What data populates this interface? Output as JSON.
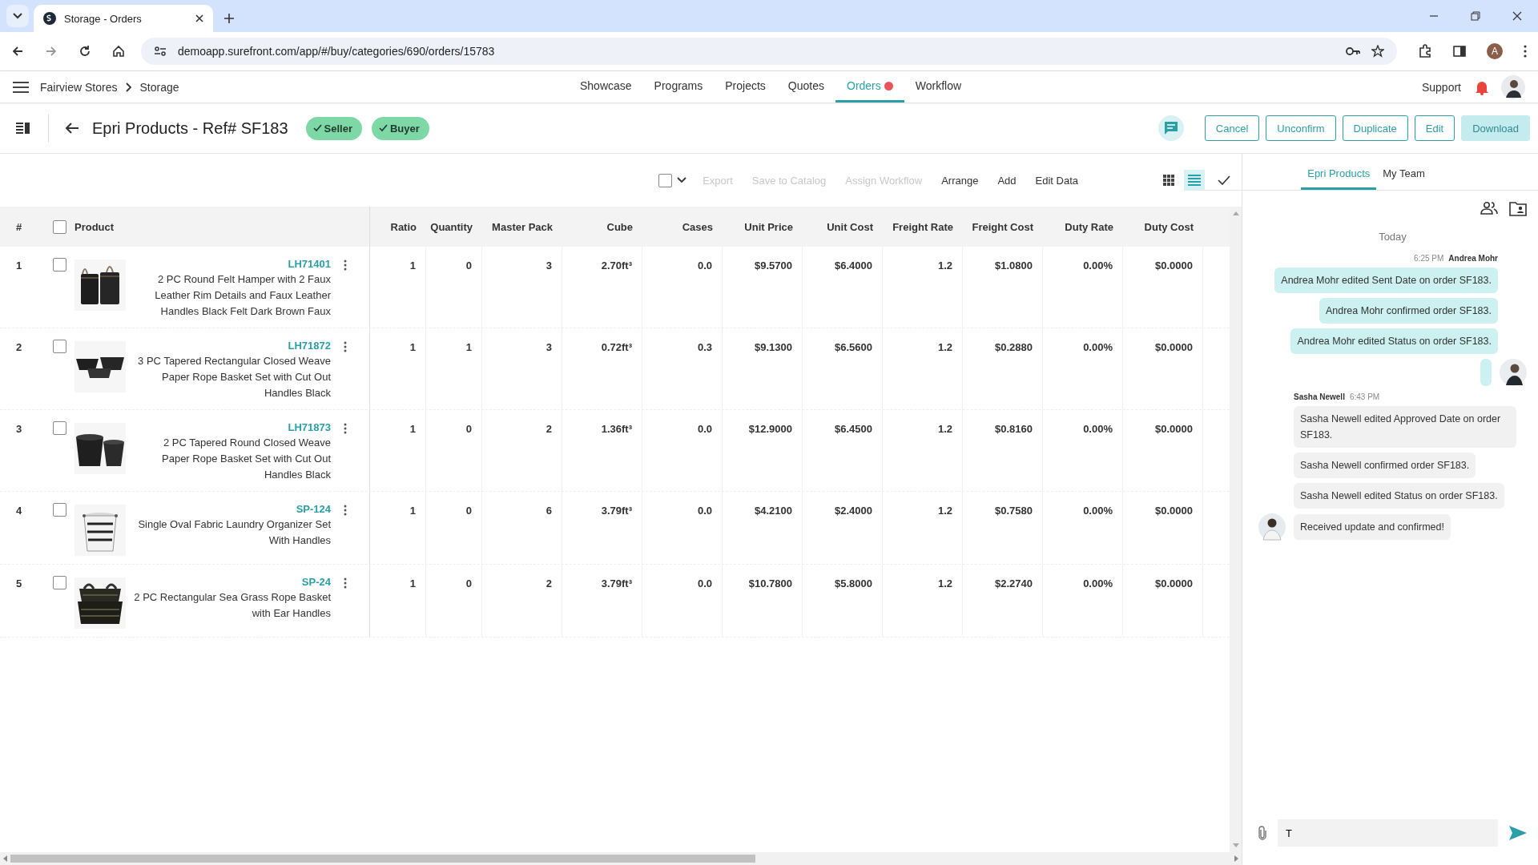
{
  "browser": {
    "tab_title": "Storage - Orders",
    "url": "demoapp.surefront.com/app/#/buy/categories/690/orders/15783",
    "profile_initial": "A"
  },
  "app_nav": {
    "breadcrumb": [
      "Fairview Stores",
      "Storage"
    ],
    "items": [
      {
        "label": "Showcase",
        "selected": false,
        "notification": false
      },
      {
        "label": "Programs",
        "selected": false,
        "notification": false
      },
      {
        "label": "Projects",
        "selected": false,
        "notification": false
      },
      {
        "label": "Quotes",
        "selected": false,
        "notification": false
      },
      {
        "label": "Orders",
        "selected": true,
        "notification": true
      },
      {
        "label": "Workflow",
        "selected": false,
        "notification": false
      }
    ],
    "support": "Support"
  },
  "header": {
    "title": "Epri Products - Ref# SF183",
    "badges": [
      "Seller",
      "Buyer"
    ],
    "buttons": [
      {
        "label": "Cancel",
        "disabled": false
      },
      {
        "label": "Unconfirm",
        "disabled": false
      },
      {
        "label": "Duplicate",
        "disabled": false
      },
      {
        "label": "Edit",
        "disabled": false
      },
      {
        "label": "Download",
        "disabled": true
      }
    ]
  },
  "toolbar": {
    "select_all_checked": false,
    "actions": [
      {
        "label": "Export",
        "disabled": true
      },
      {
        "label": "Save to Catalog",
        "disabled": true
      },
      {
        "label": "Assign Workflow",
        "disabled": true
      },
      {
        "label": "Arrange",
        "disabled": false
      },
      {
        "label": "Add",
        "disabled": false
      },
      {
        "label": "Edit Data",
        "disabled": false
      }
    ],
    "views": [
      {
        "kind": "grid",
        "selected": false
      },
      {
        "kind": "list",
        "selected": true
      }
    ]
  },
  "table": {
    "columns": [
      "#",
      "Product",
      "Ratio",
      "Quantity",
      "Master Pack",
      "Cube",
      "Cases",
      "Unit Price",
      "Unit Cost",
      "Freight Rate",
      "Freight Cost",
      "Duty Rate",
      "Duty Cost"
    ],
    "header_checked": false,
    "rows": [
      {
        "checked": false,
        "sku": "LH71401",
        "cells": [
          "1",
          "2 PC Round Felt Hamper with 2 Faux Leather Rim Details and Faux Leather Handles Black Felt Dark Brown Faux",
          "1",
          "0",
          "3",
          "2.70ft³",
          "0.0",
          "$9.5700",
          "$6.4000",
          "1.2",
          "$1.0800",
          "0.00%",
          "$0.0000"
        ]
      },
      {
        "checked": false,
        "sku": "LH71872",
        "cells": [
          "2",
          "3 PC Tapered Rectangular Closed Weave Paper Rope Basket Set with Cut Out Handles Black",
          "1",
          "1",
          "3",
          "0.72ft³",
          "0.3",
          "$9.1300",
          "$6.5600",
          "1.2",
          "$0.2880",
          "0.00%",
          "$0.0000"
        ]
      },
      {
        "checked": false,
        "sku": "LH71873",
        "cells": [
          "3",
          "2 PC Tapered Round Closed Weave Paper Rope Basket Set with Cut Out Handles Black",
          "1",
          "0",
          "2",
          "1.36ft³",
          "0.0",
          "$12.9000",
          "$6.4500",
          "1.2",
          "$0.8160",
          "0.00%",
          "$0.0000"
        ]
      },
      {
        "checked": false,
        "sku": "SP-124",
        "cells": [
          "4",
          "Single Oval Fabric Laundry Organizer Set With Handles",
          "1",
          "0",
          "6",
          "3.79ft³",
          "0.0",
          "$4.2100",
          "$2.4000",
          "1.2",
          "$0.7580",
          "0.00%",
          "$0.0000"
        ]
      },
      {
        "checked": false,
        "sku": "SP-24",
        "cells": [
          "5",
          "2 PC Rectangular Sea Grass Rope Basket with Ear Handles",
          "1",
          "0",
          "2",
          "3.79ft³",
          "0.0",
          "$10.7800",
          "$5.8000",
          "1.2",
          "$2.2740",
          "0.00%",
          "$0.0000"
        ]
      }
    ]
  },
  "chat": {
    "tabs": [
      {
        "label": "Epri Products",
        "selected": true
      },
      {
        "label": "My Team",
        "selected": false
      }
    ],
    "day": "Today",
    "groups": [
      {
        "kind": "outgoing",
        "author": "Andrea Mohr",
        "time": "6:25 PM",
        "messages": [
          "Andrea Mohr edited Sent Date on order SF183.",
          "Andrea Mohr confirmed order SF183.",
          "Andrea Mohr edited Status on order SF183."
        ]
      },
      {
        "kind": "incoming",
        "author": "Sasha Newell",
        "time": "6:43 PM",
        "messages": [
          "Sasha Newell edited Approved Date on order SF183.",
          "Sasha Newell confirmed order SF183.",
          "Sasha Newell edited Status on order SF183.",
          "Received update and confirmed!"
        ]
      }
    ],
    "composer": {
      "value": "T"
    }
  }
}
